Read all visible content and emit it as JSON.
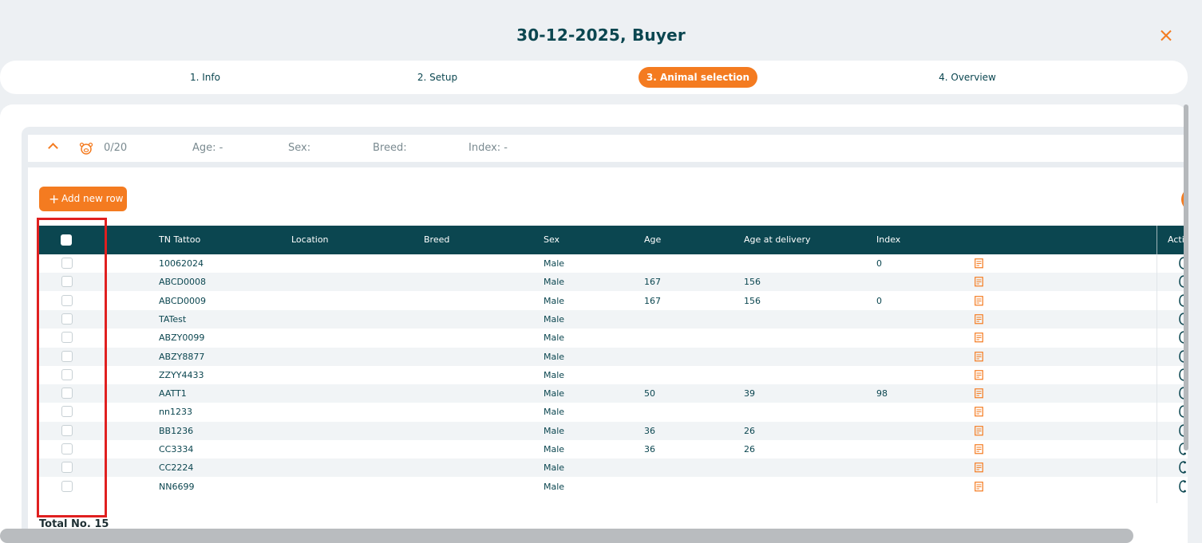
{
  "title": "30-12-2025, Buyer",
  "steps": [
    {
      "label": "1. Info"
    },
    {
      "label": "2. Setup"
    },
    {
      "label": "3. Animal selection"
    },
    {
      "label": "4. Overview"
    }
  ],
  "active_step": 2,
  "group": {
    "count": "0/20",
    "age": "Age: -",
    "sex": "Sex:",
    "breed": "Breed:",
    "index": "Index: -"
  },
  "toolbar": {
    "add_row_label": "Add new row"
  },
  "table": {
    "columns": [
      "TN Tattoo",
      "Location",
      "Breed",
      "Sex",
      "Age",
      "Age at delivery",
      "Index",
      "Acti"
    ],
    "rows": [
      {
        "tattoo": "10062024",
        "location": "",
        "breed": "",
        "sex": "Male",
        "age": "",
        "age_delivery": "",
        "index": "0"
      },
      {
        "tattoo": "ABCD0008",
        "location": "",
        "breed": "",
        "sex": "Male",
        "age": "167",
        "age_delivery": "156",
        "index": ""
      },
      {
        "tattoo": "ABCD0009",
        "location": "",
        "breed": "",
        "sex": "Male",
        "age": "167",
        "age_delivery": "156",
        "index": "0"
      },
      {
        "tattoo": "TATest",
        "location": "",
        "breed": "",
        "sex": "Male",
        "age": "",
        "age_delivery": "",
        "index": ""
      },
      {
        "tattoo": "ABZY0099",
        "location": "",
        "breed": "",
        "sex": "Male",
        "age": "",
        "age_delivery": "",
        "index": ""
      },
      {
        "tattoo": "ABZY8877",
        "location": "",
        "breed": "",
        "sex": "Male",
        "age": "",
        "age_delivery": "",
        "index": ""
      },
      {
        "tattoo": "ZZYY4433",
        "location": "",
        "breed": "",
        "sex": "Male",
        "age": "",
        "age_delivery": "",
        "index": ""
      },
      {
        "tattoo": "AATT1",
        "location": "",
        "breed": "",
        "sex": "Male",
        "age": "50",
        "age_delivery": "39",
        "index": "98"
      },
      {
        "tattoo": "nn1233",
        "location": "",
        "breed": "",
        "sex": "Male",
        "age": "",
        "age_delivery": "",
        "index": ""
      },
      {
        "tattoo": "BB1236",
        "location": "",
        "breed": "",
        "sex": "Male",
        "age": "36",
        "age_delivery": "26",
        "index": ""
      },
      {
        "tattoo": "CC3334",
        "location": "",
        "breed": "",
        "sex": "Male",
        "age": "36",
        "age_delivery": "26",
        "index": ""
      },
      {
        "tattoo": "CC2224",
        "location": "",
        "breed": "",
        "sex": "Male",
        "age": "",
        "age_delivery": "",
        "index": ""
      },
      {
        "tattoo": "NN6699",
        "location": "",
        "breed": "",
        "sex": "Male",
        "age": "",
        "age_delivery": "",
        "index": ""
      }
    ]
  },
  "total_label": "Total No. 15",
  "icons": {
    "close": "close-icon",
    "collapse": "chevron-up-icon",
    "pig": "pig-icon",
    "note": "note-icon",
    "action": "phone-icon"
  },
  "colors": {
    "accent": "#f47b20",
    "header_bg": "#0b4650",
    "highlight": "#e02020"
  }
}
